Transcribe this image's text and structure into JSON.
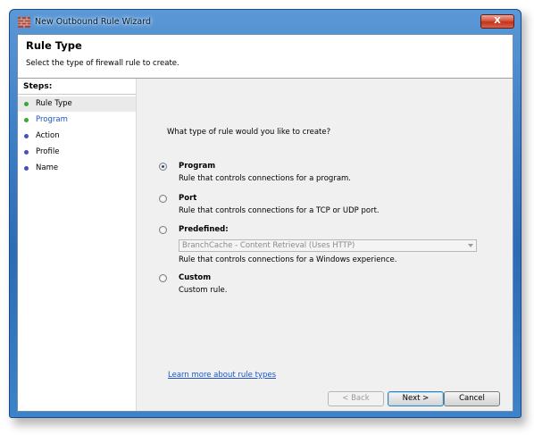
{
  "window": {
    "title": "New Outbound Rule Wizard",
    "close_label": "X"
  },
  "header": {
    "title": "Rule Type",
    "subtitle": "Select the type of firewall rule to create."
  },
  "steps": {
    "title": "Steps:",
    "items": [
      {
        "label": "Rule Type",
        "dot_color": "#39a83b",
        "current": true
      },
      {
        "label": "Program",
        "dot_color": "#39a83b",
        "current": false
      },
      {
        "label": "Action",
        "dot_color": "#4b4fb8",
        "current": false
      },
      {
        "label": "Profile",
        "dot_color": "#4b4fb8",
        "current": false
      },
      {
        "label": "Name",
        "dot_color": "#4b4fb8",
        "current": false
      }
    ]
  },
  "main": {
    "question": "What type of rule would you like to create?",
    "options": [
      {
        "label": "Program",
        "description": "Rule that controls connections for a program.",
        "selected": true
      },
      {
        "label": "Port",
        "description": "Rule that controls connections for a TCP or UDP port.",
        "selected": false
      },
      {
        "label": "Predefined:",
        "description": "Rule that controls connections for a Windows experience.",
        "selected": false
      },
      {
        "label": "Custom",
        "description": "Custom rule.",
        "selected": false
      }
    ],
    "predefined_value": "BranchCache - Content Retrieval (Uses HTTP)",
    "learn_more": "Learn more about rule types"
  },
  "buttons": {
    "back": "< Back",
    "next": "Next >",
    "cancel": "Cancel"
  },
  "colors": {
    "link": "#1a56c9",
    "current_step": "#39a83b",
    "future_step": "#4b4fb8"
  }
}
